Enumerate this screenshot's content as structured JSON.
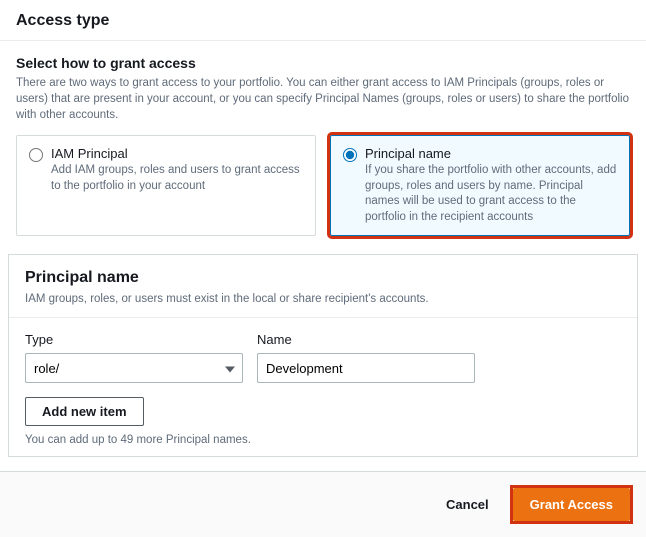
{
  "header": {
    "title": "Access type"
  },
  "access": {
    "heading": "Select how to grant access",
    "description": "There are two ways to grant access to your portfolio. You can either grant access to IAM Principals (groups, roles or users) that are present in your account, or you can specify Principal Names (groups, roles or users) to share the portfolio with other accounts.",
    "options": [
      {
        "title": "IAM Principal",
        "desc": "Add IAM groups, roles and users to grant access to the portfolio in your account",
        "selected": false
      },
      {
        "title": "Principal name",
        "desc": "If you share the portfolio with other accounts, add groups, roles and users by name. Principal names will be used to grant access to the portfolio in the recipient accounts",
        "selected": true
      }
    ]
  },
  "principal": {
    "heading": "Principal name",
    "subtext": "IAM groups, roles, or users must exist in the local or share recipient's accounts.",
    "type_label": "Type",
    "type_value": "role/",
    "name_label": "Name",
    "name_value": "Development",
    "add_button": "Add new item",
    "footnote": "You can add up to 49 more Principal names."
  },
  "footer": {
    "cancel": "Cancel",
    "grant": "Grant Access"
  }
}
